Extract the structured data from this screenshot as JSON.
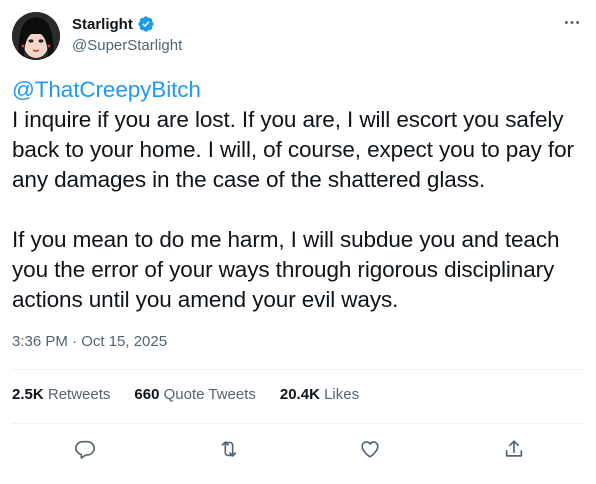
{
  "author": {
    "name": "Starlight",
    "handle": "@SuperStarlight",
    "verified": true
  },
  "tweet": {
    "mention": "@ThatCreepyBitch",
    "paragraph_1": "I inquire if you are lost. If you are, I will escort you safely back to your home. I will, of course, expect you to pay for any damages in the case of the shattered glass.",
    "paragraph_2": "If you mean to do me harm, I will subdue you and teach you the error of your ways through rigorous disciplinary actions until you amend your evil ways.",
    "timestamp": "3:36 PM · Oct 15, 2025"
  },
  "stats": {
    "retweets_value": "2.5K",
    "retweets_label": "Retweets",
    "quotes_value": "660",
    "quotes_label": "Quote Tweets",
    "likes_value": "20.4K",
    "likes_label": "Likes"
  },
  "icons": {
    "reply": "reply-icon",
    "retweet": "retweet-icon",
    "like": "like-icon",
    "share": "share-icon",
    "more": "more-icon",
    "verified": "verified-badge-icon"
  },
  "colors": {
    "accent": "#1d9bf0",
    "text": "#0f1419",
    "secondary": "#536471",
    "divider": "#eff3f4"
  }
}
